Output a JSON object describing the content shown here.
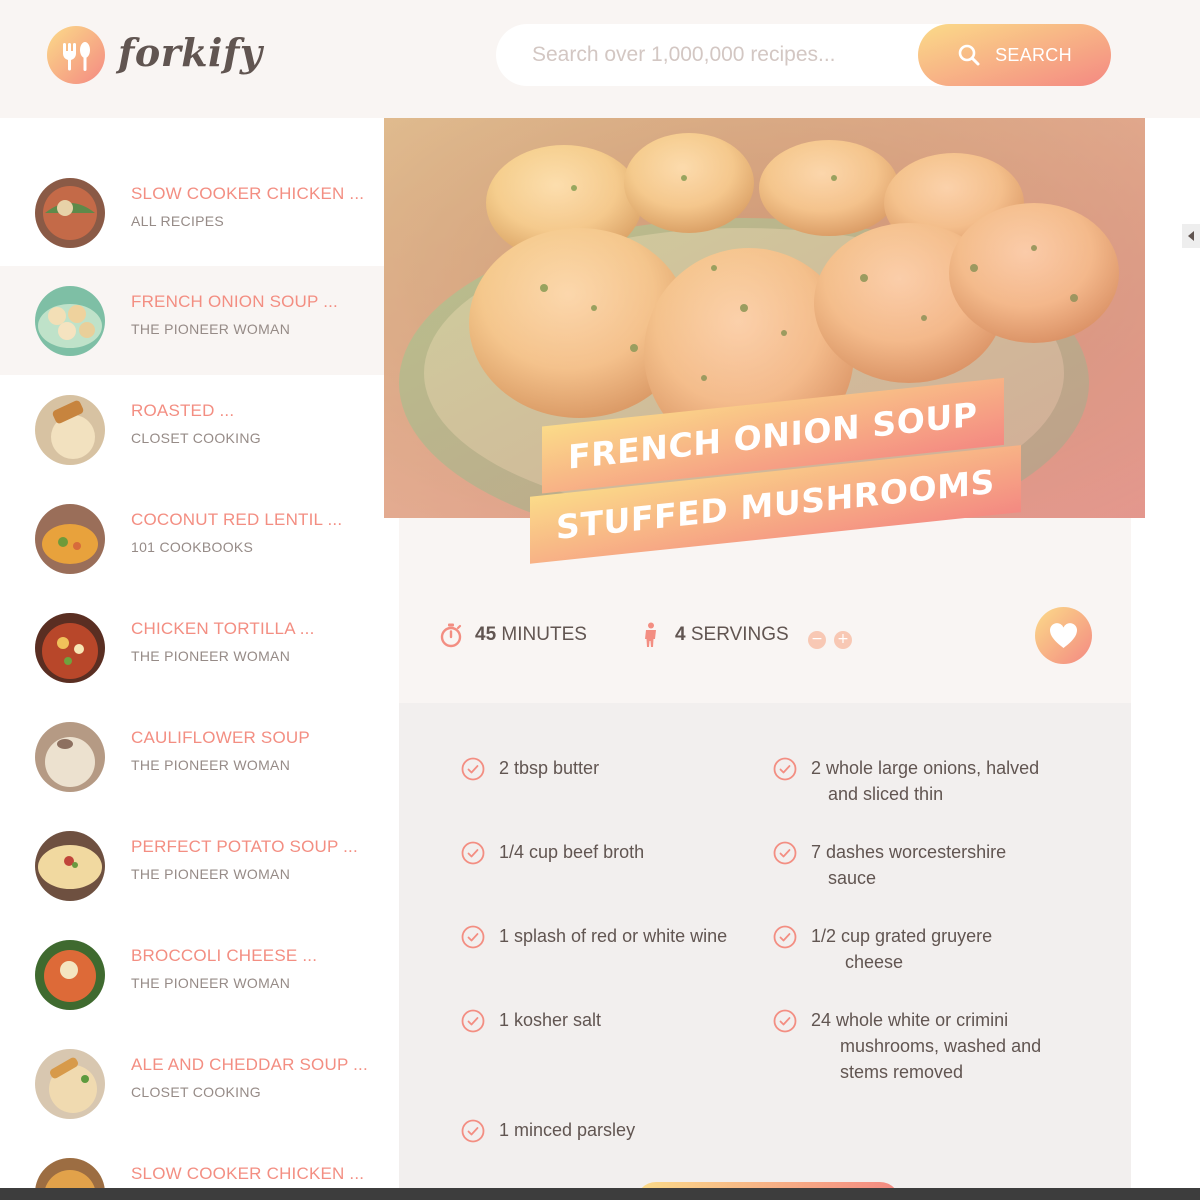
{
  "header": {
    "logo_text": "forkify",
    "search_placeholder": "Search over 1,000,000 recipes...",
    "search_button_label": "SEARCH"
  },
  "results": [
    {
      "title": "SLOW COOKER CHICKEN ...",
      "author": "ALL RECIPES",
      "active": false
    },
    {
      "title": "FRENCH ONION SOUP ...",
      "author": "THE PIONEER WOMAN",
      "active": true
    },
    {
      "title": "ROASTED ...",
      "author": "CLOSET COOKING",
      "active": false
    },
    {
      "title": "COCONUT RED LENTIL ...",
      "author": "101 COOKBOOKS",
      "active": false
    },
    {
      "title": "CHICKEN TORTILLA ...",
      "author": "THE PIONEER WOMAN",
      "active": false
    },
    {
      "title": "CAULIFLOWER SOUP",
      "author": "THE PIONEER WOMAN",
      "active": false
    },
    {
      "title": "PERFECT POTATO SOUP ...",
      "author": "THE PIONEER WOMAN",
      "active": false
    },
    {
      "title": "BROCCOLI CHEESE ...",
      "author": "THE PIONEER WOMAN",
      "active": false
    },
    {
      "title": "ALE AND CHEDDAR SOUP ...",
      "author": "CLOSET COOKING",
      "active": false
    },
    {
      "title": "SLOW COOKER CHICKEN ...",
      "author": "",
      "active": false
    }
  ],
  "recipe": {
    "title_line1": "FRENCH ONION SOUP",
    "title_line2": "STUFFED MUSHROOMS",
    "time_value": "45",
    "time_unit": "MINUTES",
    "servings_value": "4",
    "servings_unit": "SERVINGS",
    "decrease_symbol": "−",
    "increase_symbol": "+"
  },
  "ingredients": [
    {
      "lines": [
        "2  tbsp butter"
      ]
    },
    {
      "lines": [
        "2  whole large onions, halved",
        "and sliced thin"
      ]
    },
    {
      "lines": [
        "1/4  cup beef broth"
      ]
    },
    {
      "lines": [
        "7  dashes worcestershire",
        "sauce"
      ]
    },
    {
      "lines": [
        "1  splash of red or white wine"
      ]
    },
    {
      "lines": [
        "1/2  cup grated gruyere",
        "cheese"
      ]
    },
    {
      "lines": [
        "1  kosher salt"
      ]
    },
    {
      "lines": [
        "24  whole white or crimini",
        "mushrooms, washed and",
        "stems removed"
      ]
    },
    {
      "lines": [
        "1  minced parsley"
      ]
    }
  ],
  "colors": {
    "accent_start": "#fbdb89",
    "accent_end": "#f48982",
    "title_color": "#f38e82",
    "text": "#615551",
    "panel_bg": "#f9f5f3"
  },
  "icons": {
    "logo": "fork-knife-icon",
    "search": "search-icon",
    "timer": "stopwatch-icon",
    "servings": "person-icon",
    "bookmark": "heart-icon",
    "ingredient": "check-circle-icon"
  }
}
